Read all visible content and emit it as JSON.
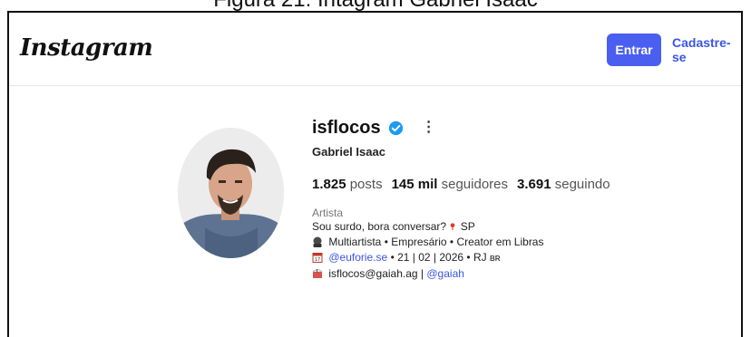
{
  "caption": "Figura 21: Intagram Gabriel Isaac",
  "header": {
    "logo": "Instagram",
    "login_label": "Entrar",
    "signup_label": "Cadastre-se"
  },
  "profile": {
    "username": "isflocos",
    "verified_icon": "verified-badge-icon",
    "more_icon": "⋮",
    "full_name": "Gabriel Isaac",
    "stats": {
      "posts_count": "1.825",
      "posts_label": "posts",
      "followers_count": "145 mil",
      "followers_label": "seguidores",
      "following_count": "3.691",
      "following_label": "seguindo"
    },
    "category": "Artista",
    "bio": {
      "line1": "Sou surdo, bora conversar?",
      "line1_tail": "SP",
      "line2": "Multiartista • Empresário • Creator em Libras",
      "line3_link": "@euforie.se",
      "line3_text": " • 21 | 02 | 2026 • RJ ",
      "line3_flag": "BR",
      "line4_text": "isflocos@gaiah.ag | ",
      "line4_link": "@gaiah"
    }
  },
  "colors": {
    "primary_button": "#4a5ef0",
    "link": "#3b55e6",
    "verified": "#1d9bf0"
  }
}
